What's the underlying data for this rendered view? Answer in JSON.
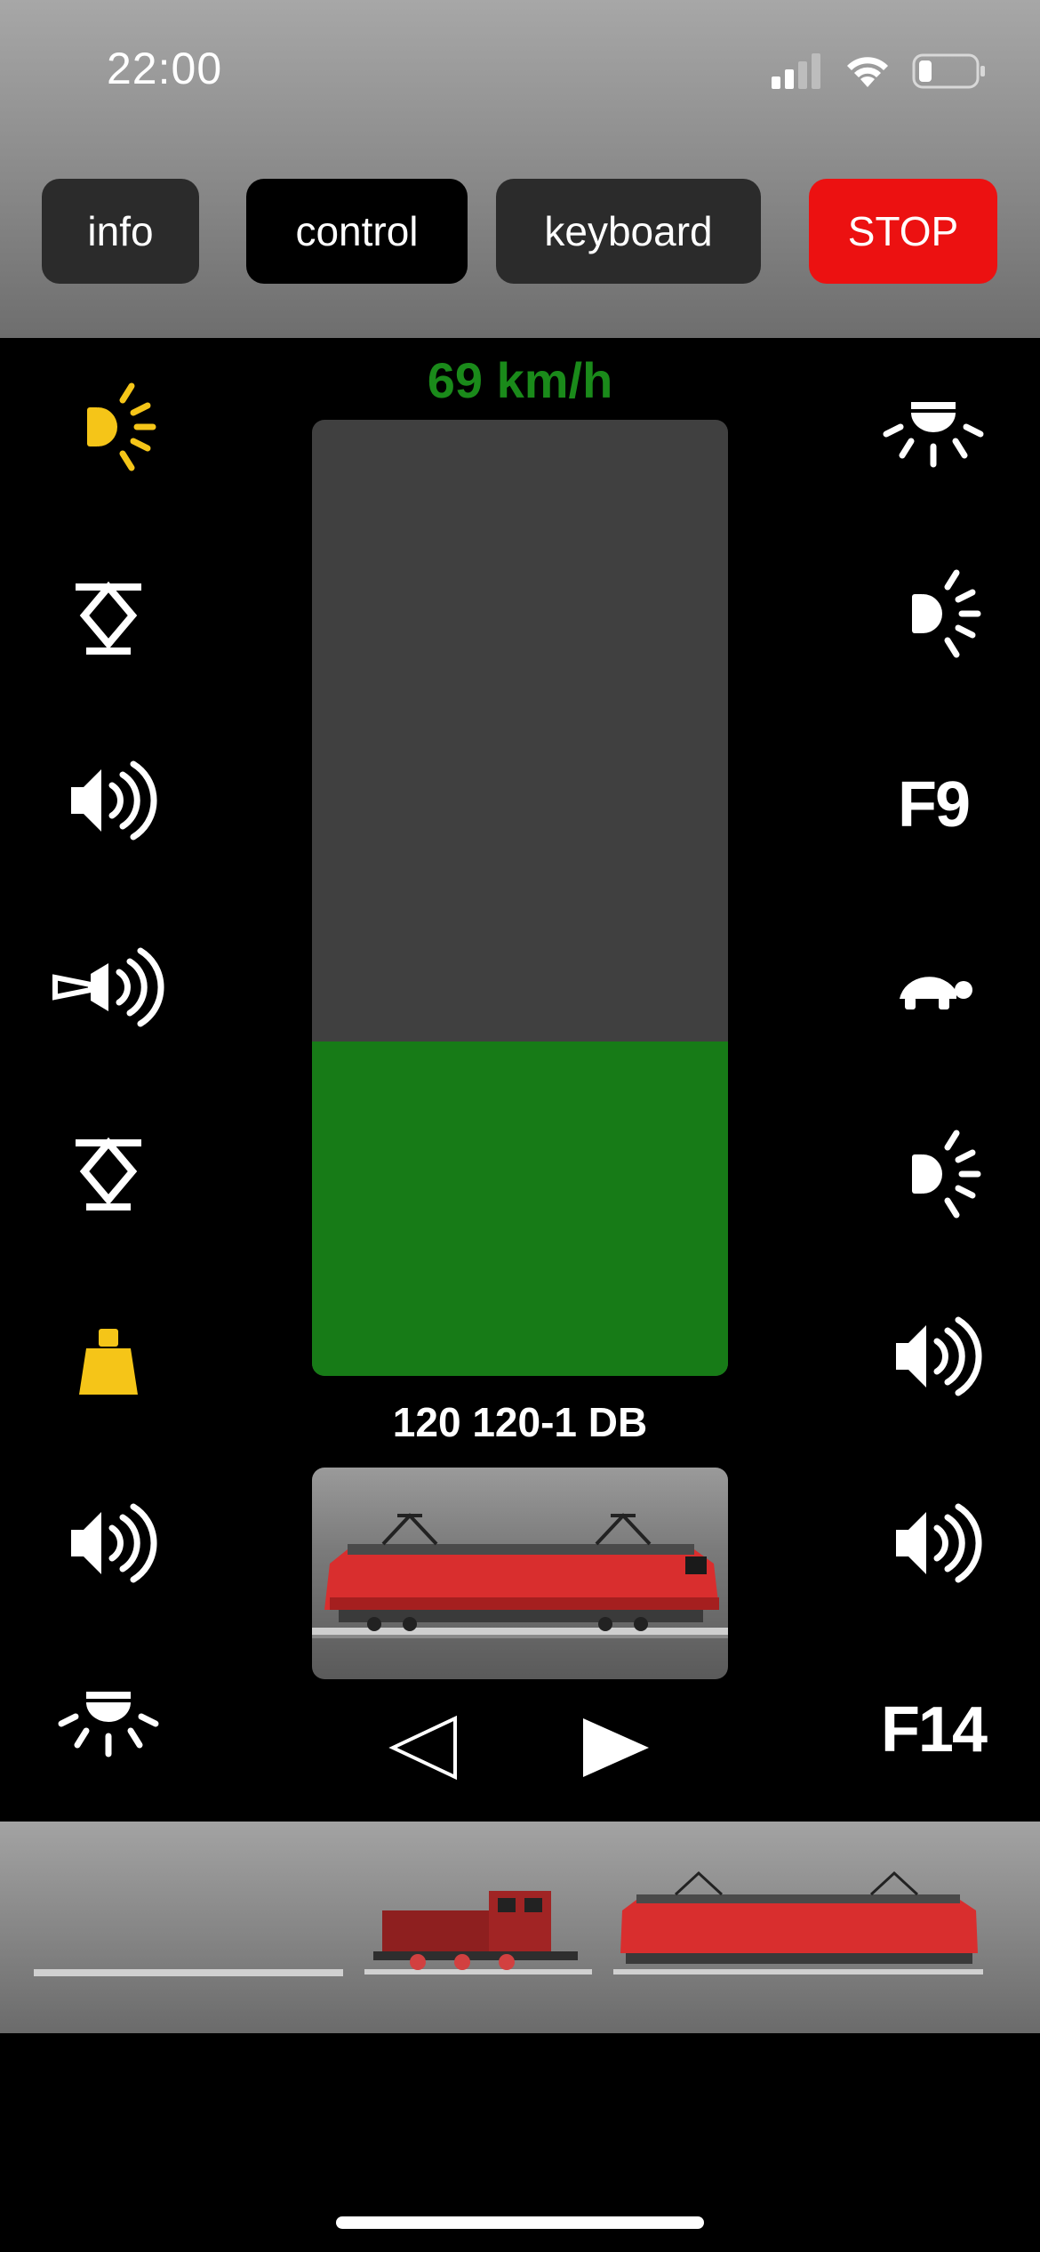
{
  "status_bar": {
    "time": "22:00",
    "signal_icon": "cellular-signal-icon",
    "wifi_icon": "wifi-icon",
    "battery_icon": "battery-icon"
  },
  "tabs": {
    "info": "info",
    "control": "control",
    "keyboard": "keyboard",
    "stop": "STOP",
    "active": "control"
  },
  "speed": {
    "label": "69 km/h",
    "level_fraction": 0.35
  },
  "locomotive": {
    "name": "120 120-1 DB"
  },
  "functions_left": [
    "headlight-icon-active",
    "pantograph-icon",
    "sound-icon",
    "horn-icon",
    "pantograph-icon",
    "weight-icon-active",
    "sound-icon",
    "ceiling-light-icon"
  ],
  "functions_right": {
    "f9": "F9",
    "f14": "F14"
  },
  "direction": {
    "left": "reverse-arrow-icon",
    "right": "forward-arrow-icon"
  },
  "colors": {
    "active_icon": "#f5c518",
    "speed_text": "#1a8a1a",
    "speed_fill": "#177b17",
    "stop": "#ec1111"
  }
}
